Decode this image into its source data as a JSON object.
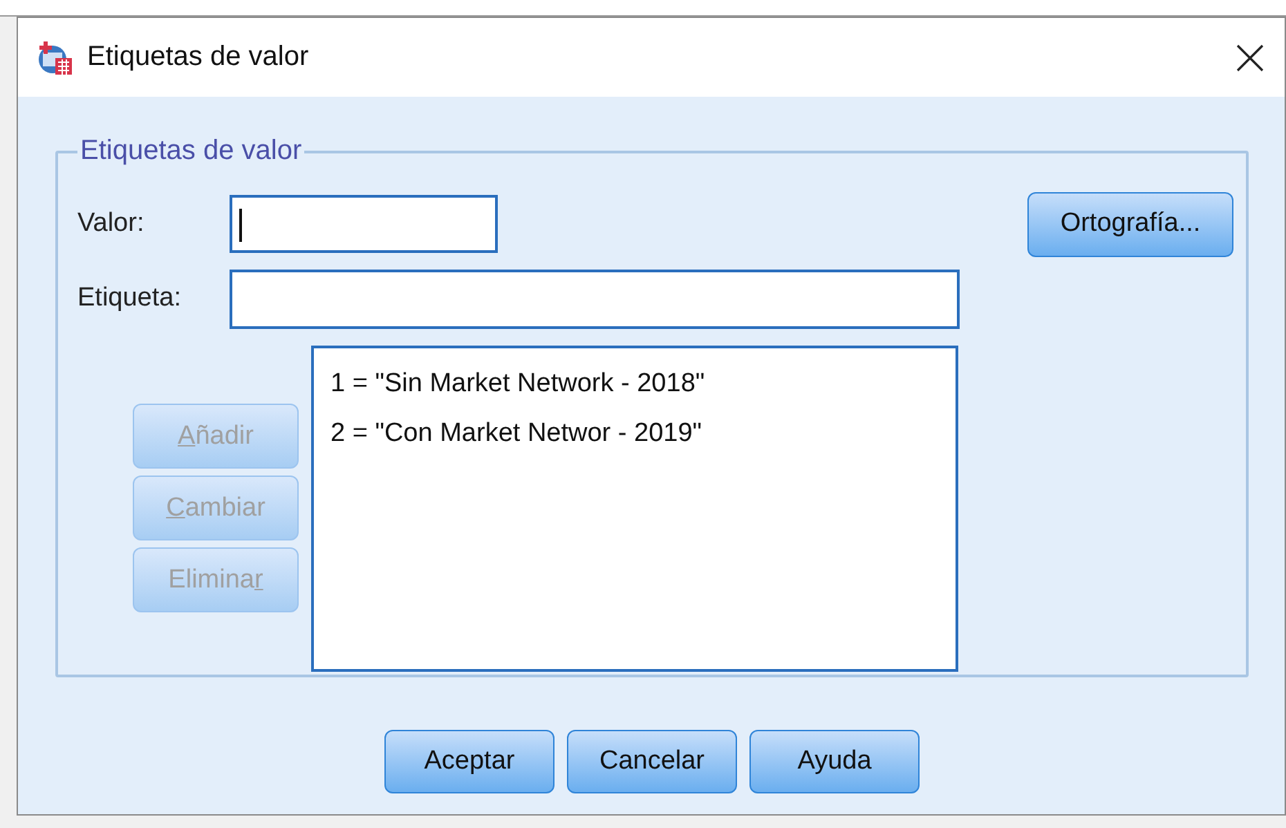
{
  "window": {
    "title": "Etiquetas de valor"
  },
  "group": {
    "title": "Etiquetas de valor"
  },
  "value_field": {
    "label": "Valor:",
    "focused": true
  },
  "label_field": {
    "label": "Etiqueta:"
  },
  "spelling_button": {
    "label": "Ortografía..."
  },
  "side_buttons": [
    {
      "key": "A",
      "after": "ñadir",
      "disabled": true
    },
    {
      "key": "C",
      "after": "ambiar",
      "disabled": true
    },
    {
      "before": "Elimina",
      "key": "r",
      "disabled": true
    }
  ],
  "labels_list": [
    "1 = \"Sin Market Network - 2018\"",
    "2 = \"Con Market Networ - 2019\""
  ],
  "buttons": [
    "Aceptar",
    "Cancelar",
    "Ayuda"
  ]
}
